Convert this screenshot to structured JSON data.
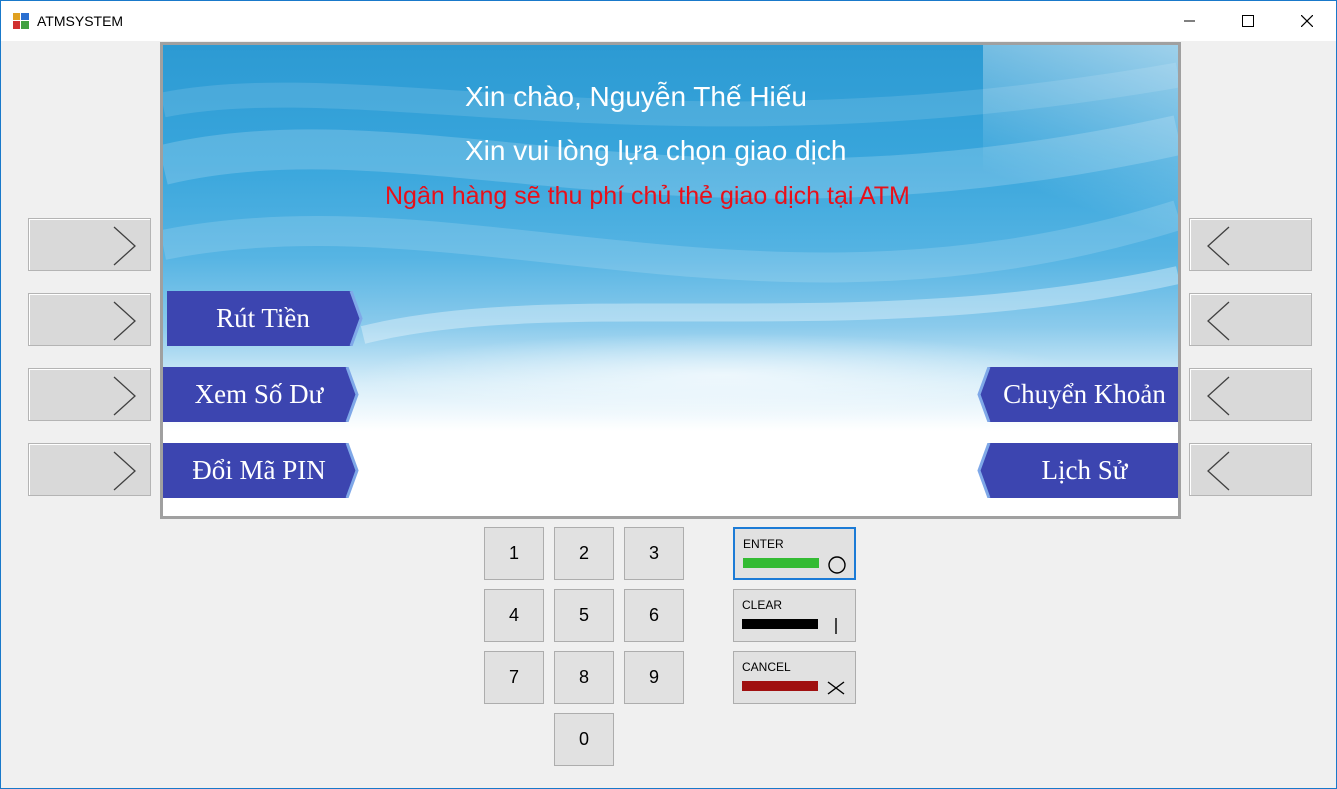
{
  "window": {
    "title": "ATMSYSTEM"
  },
  "screen": {
    "greeting": "Xin chào, Nguyễn Thế Hiếu",
    "prompt": "Xin vui lòng lựa chọn giao dịch",
    "notice": "Ngân hàng sẽ thu phí chủ thẻ giao dịch tại ATM",
    "menu": {
      "withdraw": "Rút Tiền",
      "balance": "Xem Số Dư",
      "change_pin": "Đổi Mã PIN",
      "transfer": "Chuyển Khoản",
      "history": "Lịch Sử"
    }
  },
  "keypad": {
    "keys": [
      "1",
      "2",
      "3",
      "4",
      "5",
      "6",
      "7",
      "8",
      "9",
      "0"
    ]
  },
  "function_keys": {
    "enter": {
      "label": "ENTER",
      "color": "#33bb33"
    },
    "clear": {
      "label": "CLEAR",
      "color": "#000000"
    },
    "cancel": {
      "label": "CANCEL",
      "color": "#a01010"
    }
  },
  "colors": {
    "menu_button": "#3c45b0",
    "notice_text": "#e8101a",
    "focus_border": "#1c7bd6"
  }
}
